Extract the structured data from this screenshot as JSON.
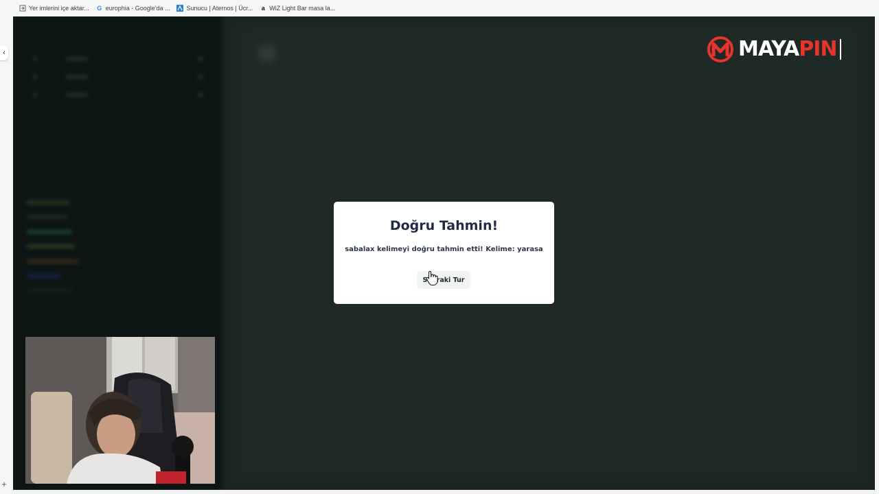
{
  "bookmarks": [
    {
      "icon": "import-bookmarks-icon",
      "label": "Yer imlerini içe aktar..."
    },
    {
      "icon": "google-icon",
      "label": "europhia - Google'da ..."
    },
    {
      "icon": "aternos-icon",
      "label": "Sunucu | Aternos | Ücr..."
    },
    {
      "icon": "amazon-icon",
      "label": "WiZ Light Bar masa la..."
    }
  ],
  "browser": {
    "side_tab_glyph": "‹",
    "new_tab_glyph": "+"
  },
  "logo": {
    "word_main": "MAYA",
    "word_accent": "PIN",
    "accent_color": "#e8342c"
  },
  "modal": {
    "title": "Doğru Tahmin!",
    "message": "sabalax kelimeyi doğru tahmin etti! Kelime: yarasa",
    "next_button": "Sonraki Tur"
  },
  "colors": {
    "app_background": "#1e2b28",
    "sidebar_background": "#0f1a18",
    "modal_title": "#1f2a44"
  }
}
